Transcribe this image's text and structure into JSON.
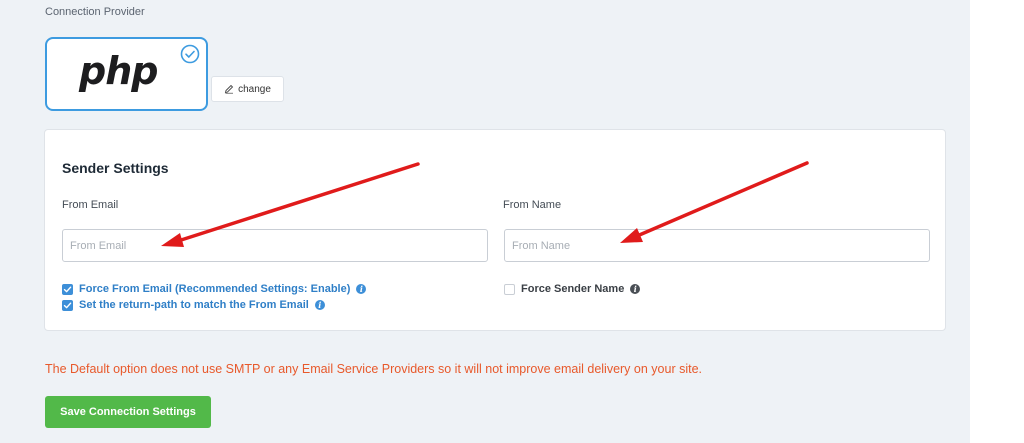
{
  "provider": {
    "section_title": "Connection Provider",
    "selected_logo_text": "php",
    "change_label": "change"
  },
  "sender": {
    "title": "Sender Settings",
    "from_email_label": "From Email",
    "from_email_placeholder": "From Email",
    "from_email_value": "",
    "from_name_label": "From Name",
    "from_name_placeholder": "From Name",
    "from_name_value": "",
    "options": [
      {
        "label": "Force From Email (Recommended Settings: Enable)",
        "checked": true
      },
      {
        "label": "Set the return-path to match the From Email",
        "checked": true
      },
      {
        "label": "Force Sender Name",
        "checked": false
      }
    ]
  },
  "warning": "The Default option does not use SMTP or any Email Service Providers so it will not improve email delivery on your site.",
  "save_label": "Save Connection Settings",
  "colors": {
    "accent": "#3d9be0",
    "save_green": "#52b949",
    "warning_orange": "#e8592b",
    "annotation_arrow": "#e01b1b"
  },
  "icons": [
    "check-circle-icon",
    "pencil-icon",
    "checkbox-check-icon",
    "info-icon",
    "annotation-arrow"
  ]
}
